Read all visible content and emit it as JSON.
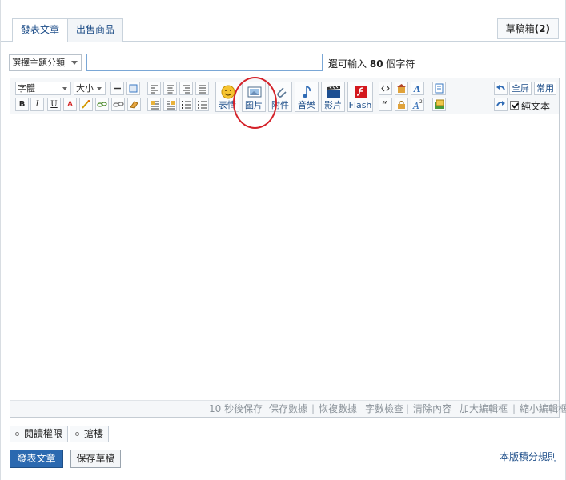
{
  "tabs": {
    "post_article": "發表文章",
    "sell_item": "出售商品",
    "drafts_label": "草稿箱",
    "drafts_count": "(2)"
  },
  "subject": {
    "category_select": "選擇主題分類",
    "title_value": "",
    "chars_prefix": "還可輸入",
    "chars_count": "80",
    "chars_suffix": "個字符"
  },
  "toolbar": {
    "font_dropdown": "字體",
    "size_dropdown": "大小",
    "bold": "B",
    "italic": "I",
    "underline": "U",
    "font_color": "A",
    "big_buttons": {
      "emoticon": "表情",
      "image": "圖片",
      "attachment": "附件",
      "music": "音樂",
      "video": "影片",
      "flash": "Flash"
    },
    "fullscreen": "全屏",
    "common": "常用",
    "plain_text": "純文本"
  },
  "statusbar": {
    "autosave": "10 秒後保存",
    "save_data": "保存數據",
    "restore_data": "恢複數據",
    "check_length": "字數檢查",
    "clear_content": "清除內容",
    "enlarge": "加大編輯框",
    "shrink": "縮小編輯框",
    "separator": "|"
  },
  "options": {
    "read_permission": "閱讀權限",
    "grab_floor": "搶樓"
  },
  "actions": {
    "post_button": "發表文章",
    "save_draft_button": "保存草稿",
    "rules_link": "本版積分規則"
  },
  "colors": {
    "accent": "#2b69b0",
    "link": "#1f4f8a",
    "highlight_circle": "#d4222a"
  }
}
